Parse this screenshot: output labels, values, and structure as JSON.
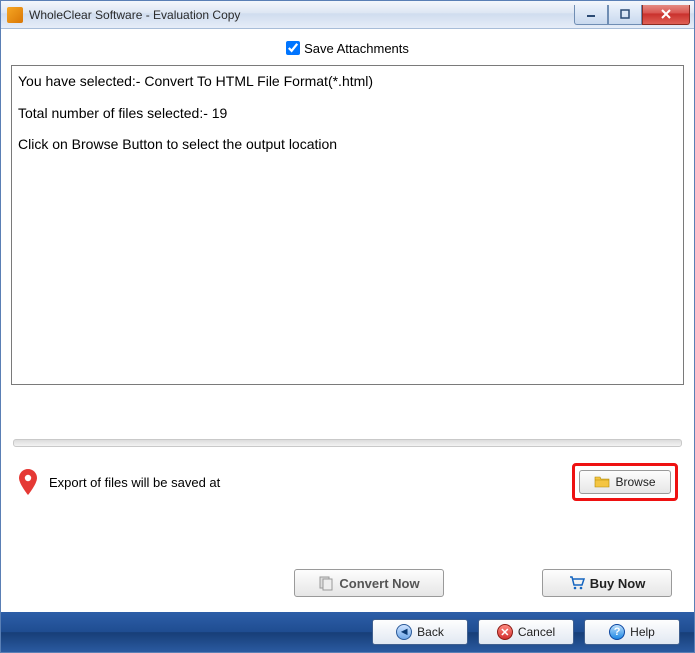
{
  "titlebar": {
    "title": "WholeClear Software - Evaluation Copy"
  },
  "save_attachments": {
    "label": "Save Attachments",
    "checked": true
  },
  "info": {
    "line1": "You have selected:- Convert To HTML File Format(*.html)",
    "line2": "Total number of files selected:- 19",
    "line3": "Click on Browse Button to select the output location"
  },
  "export": {
    "label": "Export of files will be saved at",
    "browse_label": "Browse"
  },
  "actions": {
    "convert_label": "Convert Now",
    "buynow_label": "Buy Now"
  },
  "footer": {
    "back_label": "Back",
    "cancel_label": "Cancel",
    "help_label": "Help"
  }
}
